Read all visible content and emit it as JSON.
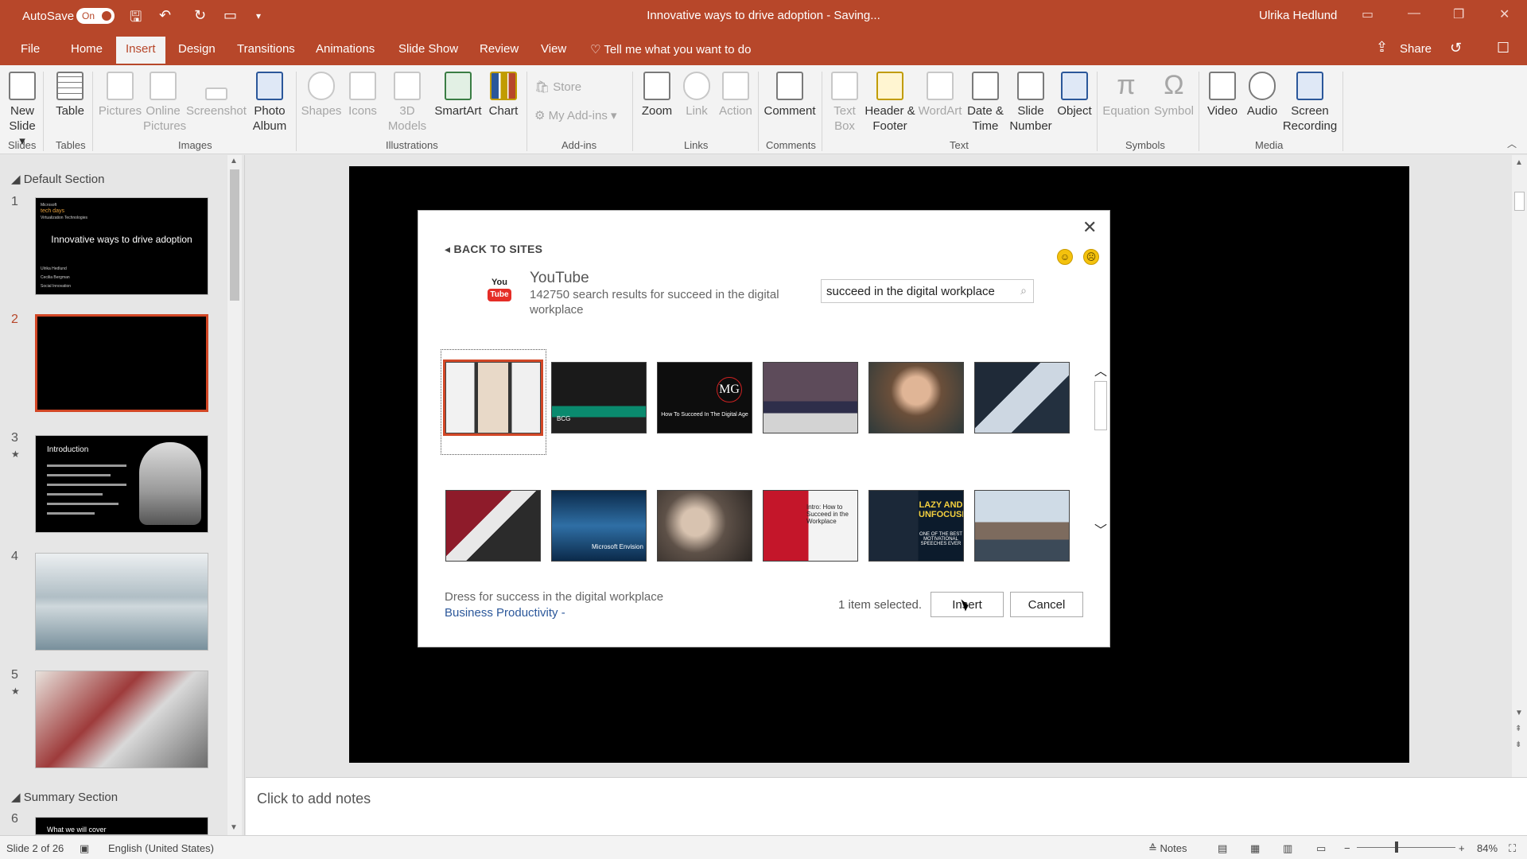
{
  "titlebar": {
    "autosave_label": "AutoSave",
    "autosave_state": "On",
    "document_title": "Innovative ways to drive adoption  -  Saving...",
    "user": "Ulrika Hedlund"
  },
  "tabs": [
    "File",
    "Home",
    "Insert",
    "Design",
    "Transitions",
    "Animations",
    "Slide Show",
    "Review",
    "View"
  ],
  "active_tab": "Insert",
  "tell_me": "Tell me what you want to do",
  "share_label": "Share",
  "ribbon": {
    "slides": {
      "new_slide": "New Slide",
      "group": "Slides"
    },
    "tables": {
      "table": "Table",
      "group": "Tables"
    },
    "images": {
      "pictures": "Pictures",
      "online_pictures": "Online Pictures",
      "screenshot": "Screenshot",
      "photo_album": "Photo Album",
      "group": "Images"
    },
    "illustrations": {
      "shapes": "Shapes",
      "icons": "Icons",
      "models_3d": "3D Models",
      "smartart": "SmartArt",
      "chart": "Chart",
      "group": "Illustrations"
    },
    "addins": {
      "store": "Store",
      "my_addins": "My Add-ins",
      "group": "Add-ins"
    },
    "links": {
      "zoom": "Zoom",
      "link": "Link",
      "action": "Action",
      "group": "Links"
    },
    "comments": {
      "comment": "Comment",
      "group": "Comments"
    },
    "text": {
      "text_box": "Text Box",
      "header_footer": "Header & Footer",
      "wordart": "WordArt",
      "date_time": "Date & Time",
      "slide_number": "Slide Number",
      "object": "Object",
      "group": "Text"
    },
    "symbols": {
      "equation": "Equation",
      "symbol": "Symbol",
      "group": "Symbols"
    },
    "media": {
      "video": "Video",
      "audio": "Audio",
      "screen_recording": "Screen Recording",
      "group": "Media"
    }
  },
  "slides_pane": {
    "section_default": "Default Section",
    "section_summary": "Summary Section",
    "slide_numbers": [
      "1",
      "2",
      "3",
      "4",
      "5",
      "6"
    ],
    "slide1": {
      "brand_line1": "Microsoft",
      "brand_line2": "tech days",
      "brand_line3": "Virtualization Technologies",
      "title": "Innovative ways to drive adoption",
      "names": [
        "Ulrika Hedlund",
        "Cecilia Bergman",
        "Social Innovation"
      ]
    },
    "slide3": {
      "title": "Introduction"
    },
    "slide6": {
      "title": "What we will cover"
    }
  },
  "notes_placeholder": "Click to add notes",
  "status": {
    "slide_info": "Slide 2 of 26",
    "language": "English (United States)",
    "notes_label": "Notes",
    "zoom": "84%"
  },
  "dialog": {
    "back_label": "BACK TO SITES",
    "site_name": "YouTube",
    "logo_top": "You",
    "logo_bottom": "Tube",
    "result_summary": "142750 search results for succeed in the digital workplace",
    "search_value": "succeed in the digital workplace",
    "thumb_captions": {
      "mg": "MG",
      "mg_sub": "How To Succeed In The Digital Age",
      "intro": "Intro: How to Succeed in the Workplace",
      "lazy": "LAZY AND UNFOCUSED",
      "lazy_sub": "ONE OF THE BEST MOTIVATIONAL SPEECHES EVER",
      "envision": "Microsoft Envision",
      "bcg": "BCG"
    },
    "selected_title": "Dress for success in the digital workplace",
    "selected_category": "Business Productivity -",
    "selection_count": "1 item selected.",
    "insert_label": "Insert",
    "cancel_label": "Cancel"
  },
  "colors": {
    "accent": "#b7472a",
    "selection": "#d24726",
    "link": "#2b579a"
  }
}
